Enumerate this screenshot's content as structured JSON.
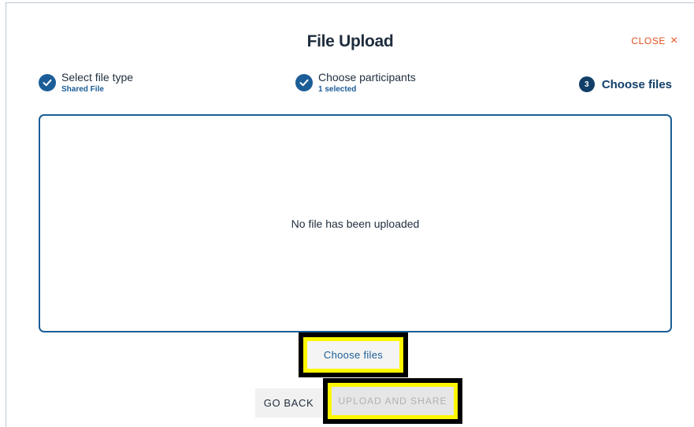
{
  "dialog": {
    "title": "File Upload",
    "close_label": "CLOSE",
    "close_glyph": "×"
  },
  "steps": [
    {
      "label": "Select file type",
      "sub": "Shared File",
      "state": "complete"
    },
    {
      "label": "Choose participants",
      "sub": "1 selected",
      "state": "complete"
    },
    {
      "number": "3",
      "label": "Choose files",
      "state": "current"
    }
  ],
  "dropzone": {
    "empty_text": "No file has been uploaded"
  },
  "buttons": {
    "choose_files": "Choose files",
    "go_back": "GO BACK",
    "upload_and_share": "UPLOAD AND SHARE"
  },
  "colors": {
    "accent": "#1b5d97",
    "accent_dark": "#123f68",
    "close": "#e0521f",
    "highlight": "#fff700"
  },
  "icons": {
    "step_complete": "check-circle-icon",
    "close": "close-icon"
  }
}
